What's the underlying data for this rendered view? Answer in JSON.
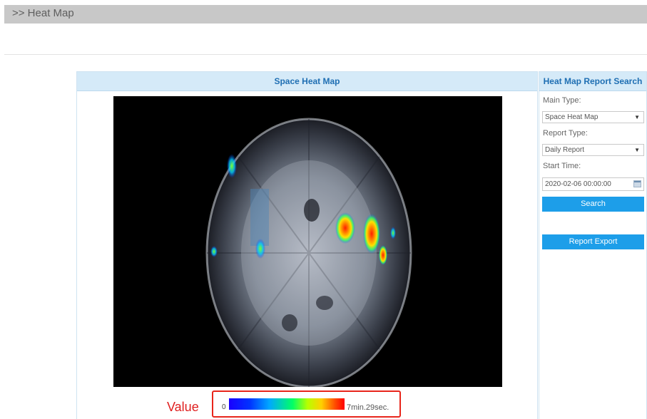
{
  "breadcrumb": {
    "text": ">> Heat Map"
  },
  "main_panel": {
    "title": "Space Heat Map",
    "legend": {
      "label": "Value",
      "min": "0",
      "max": "7min.29sec."
    }
  },
  "search_panel": {
    "title": "Heat Map Report Search",
    "main_type_label": "Main Type:",
    "main_type_value": "Space Heat Map",
    "report_type_label": "Report Type:",
    "report_type_value": "Daily Report",
    "start_time_label": "Start Time:",
    "start_time_value": "2020-02-06 00:00:00",
    "search_button": "Search",
    "export_button": "Report Export"
  },
  "colors": {
    "accent": "#1d9ee9",
    "panel_header": "#d5eaf8",
    "legend_border": "#e8251b"
  },
  "icons": [
    "dropdown-caret-icon",
    "calendar-icon"
  ]
}
